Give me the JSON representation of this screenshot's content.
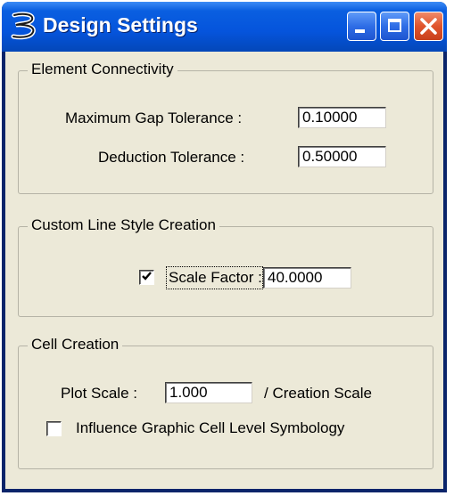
{
  "window": {
    "title": "Design Settings"
  },
  "element_connectivity": {
    "legend": "Element Connectivity",
    "max_gap_label": "Maximum Gap Tolerance :",
    "max_gap_value": "0.10000",
    "deduction_label": "Deduction Tolerance :",
    "deduction_value": "0.50000"
  },
  "custom_line_style": {
    "legend": "Custom Line Style Creation",
    "scale_factor_checked": true,
    "scale_factor_label": "Scale Factor :",
    "scale_factor_value": "40.0000"
  },
  "cell_creation": {
    "legend": "Cell Creation",
    "plot_scale_label": "Plot Scale :",
    "plot_scale_value": "1.000",
    "creation_scale_label": "/ Creation Scale",
    "influence_checked": false,
    "influence_label": "Influence Graphic Cell Level Symbology"
  },
  "icons": {
    "app": "microstation-b-icon",
    "minimize": "minimize-icon",
    "maximize": "maximize-icon",
    "close": "close-icon",
    "check": "checkmark-icon"
  },
  "colors": {
    "titlebar": "#0554dc",
    "dialog_bg": "#ece9d8",
    "close_button": "#e0542c"
  }
}
